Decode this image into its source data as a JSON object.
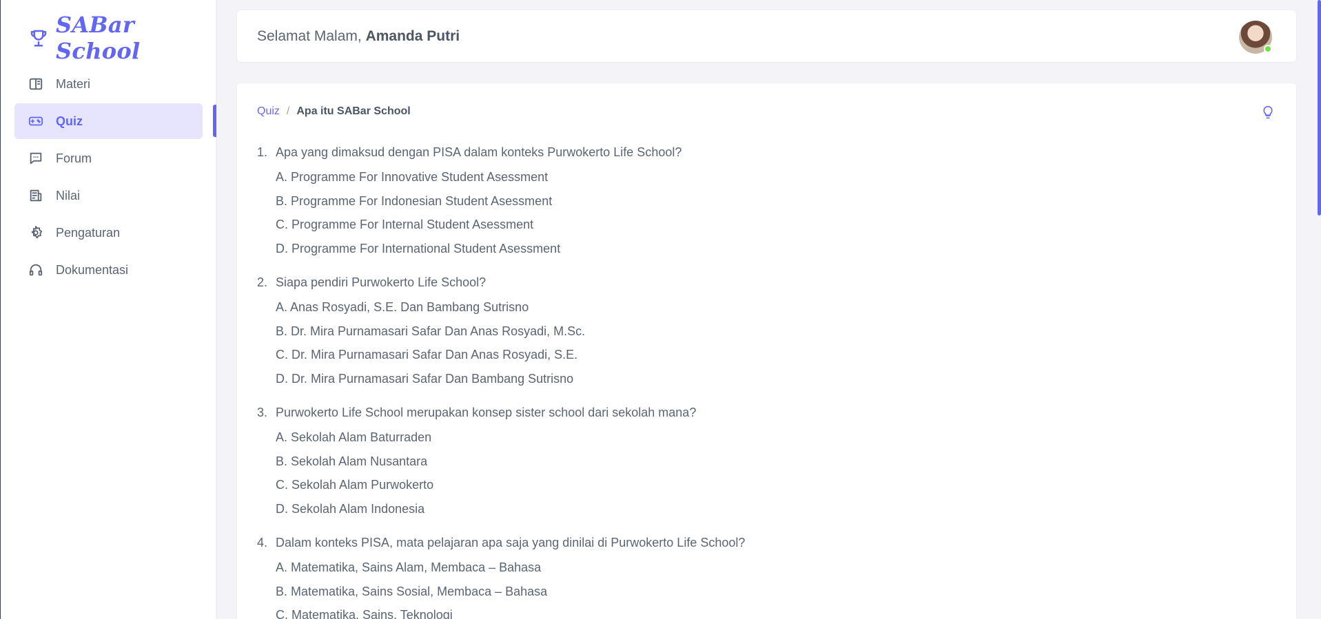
{
  "brand": {
    "name": "SABar School",
    "icon": "trophy-icon"
  },
  "sidebar": {
    "items": [
      {
        "label": "Materi",
        "icon": "book-open-icon",
        "active": false
      },
      {
        "label": "Quiz",
        "icon": "gamepad-icon",
        "active": true
      },
      {
        "label": "Forum",
        "icon": "message-dots-icon",
        "active": false
      },
      {
        "label": "Nilai",
        "icon": "report-icon",
        "active": false
      },
      {
        "label": "Pengaturan",
        "icon": "gear-icon",
        "active": false
      },
      {
        "label": "Dokumentasi",
        "icon": "headphones-icon",
        "active": false
      }
    ]
  },
  "header": {
    "greeting": "Selamat Malam,",
    "user_name": "Amanda Putri",
    "status": "online"
  },
  "breadcrumb": {
    "parent": "Quiz",
    "separator": "/",
    "current": "Apa itu SABar School"
  },
  "hint_icon": "lightbulb-icon",
  "questions": [
    {
      "number": "1.",
      "text": "Apa yang dimaksud dengan PISA dalam konteks Purwokerto Life School?",
      "options": [
        "A. Programme For Innovative Student Asessment",
        "B. Programme For Indonesian Student Asessment",
        "C. Programme For Internal Student Asessment",
        "D. Programme For International Student Asessment"
      ]
    },
    {
      "number": "2.",
      "text": "Siapa pendiri Purwokerto Life School?",
      "options": [
        "A. Anas Rosyadi, S.E. Dan Bambang Sutrisno",
        "B. Dr. Mira Purnamasari Safar Dan Anas Rosyadi, M.Sc.",
        "C. Dr. Mira Purnamasari Safar Dan Anas Rosyadi, S.E.",
        "D. Dr. Mira Purnamasari Safar Dan Bambang Sutrisno"
      ]
    },
    {
      "number": "3.",
      "text": "Purwokerto Life School merupakan konsep sister school dari sekolah mana?",
      "options": [
        "A. Sekolah Alam Baturraden",
        "B. Sekolah Alam Nusantara",
        "C. Sekolah Alam Purwokerto",
        "D. Sekolah Alam Indonesia"
      ]
    },
    {
      "number": "4.",
      "text": "Dalam konteks PISA, mata pelajaran apa saja yang dinilai di Purwokerto Life School?",
      "options": [
        "A. Matematika, Sains Alam, Membaca – Bahasa",
        "B. Matematika, Sains Sosial, Membaca – Bahasa",
        "C. Matematika, Sains, Teknologi"
      ]
    }
  ],
  "colors": {
    "accent": "#6366f1",
    "active_bg": "#e6e5fd",
    "online": "#6ee04a"
  }
}
